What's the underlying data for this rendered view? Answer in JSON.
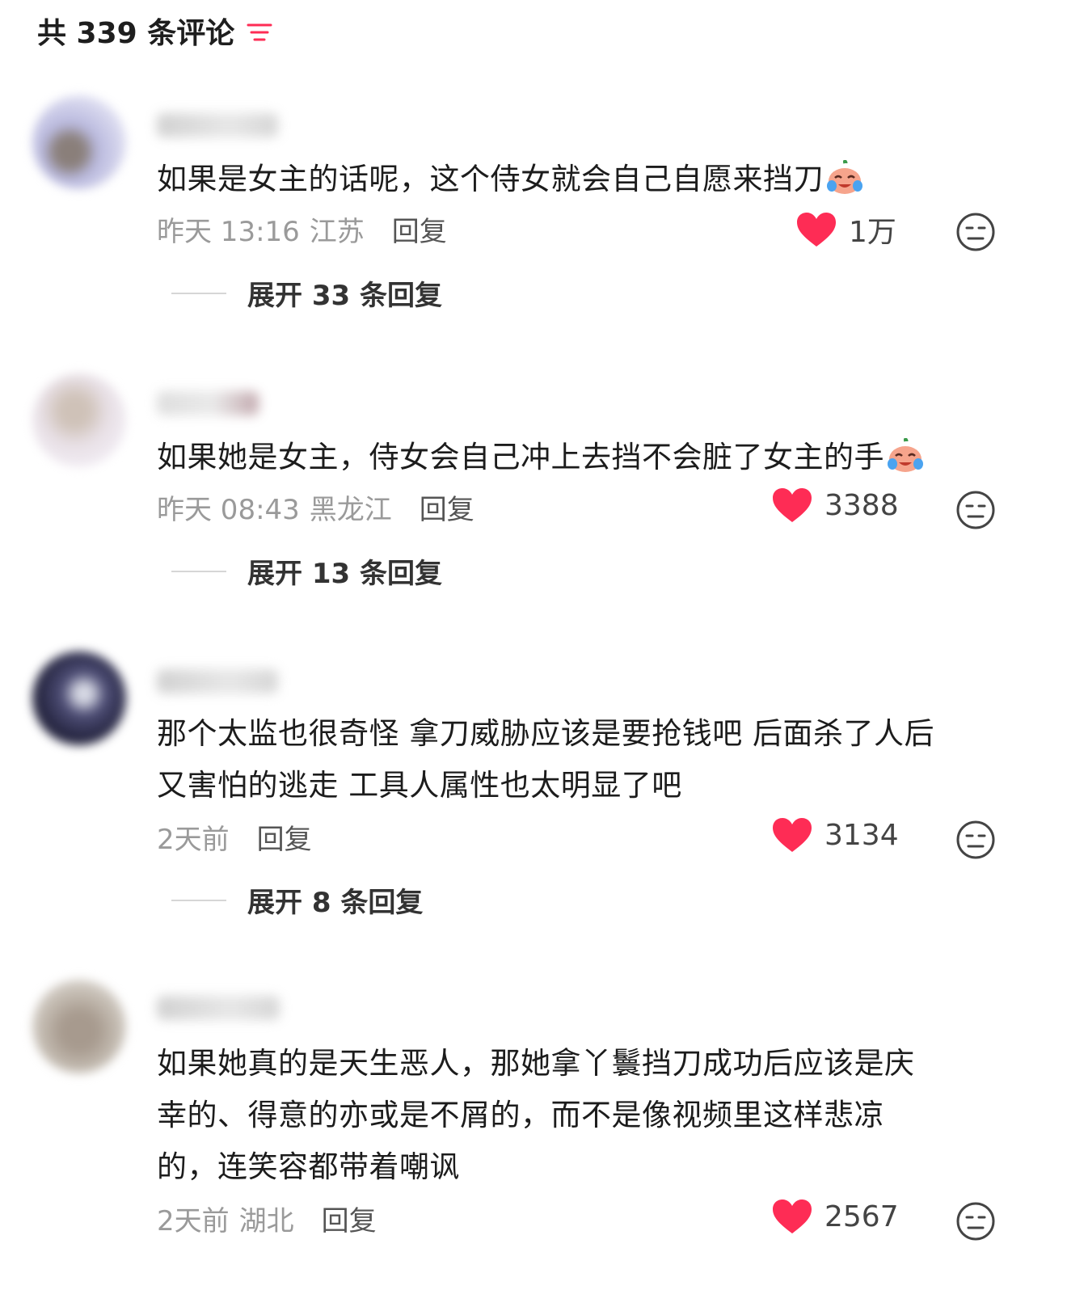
{
  "header": {
    "title": "共 339 条评论"
  },
  "comments": [
    {
      "text": "如果是女主的话呢，这个侍女就会自己自愿来挡刀",
      "time": "昨天 13:16",
      "location": "江苏",
      "reply_label": "回复",
      "likes": "1万",
      "expand_label": "展开 33 条回复"
    },
    {
      "text": "如果她是女主，侍女会自己冲上去挡不会脏了女主的手",
      "time": "昨天 08:43",
      "location": "黑龙江",
      "reply_label": "回复",
      "likes": "3388",
      "expand_label": "展开 13 条回复"
    },
    {
      "text_line1": "那个太监也很奇怪 拿刀威胁应该是要抢钱吧 后面杀了人后",
      "text_line2": "又害怕的逃走 工具人属性也太明显了吧",
      "time": "2天前",
      "reply_label": "回复",
      "likes": "3134",
      "expand_label": "展开 8 条回复"
    },
    {
      "text_line1": "如果她真的是天生恶人，那她拿丫鬟挡刀成功后应该是庆",
      "text_line2": "幸的、得意的亦或是不屑的，而不是像视频里这样悲凉",
      "text_line3": "的，连笑容都带着嘲讽",
      "time": "2天前",
      "location": "湖北",
      "reply_label": "回复",
      "likes": "2567"
    }
  ],
  "colors": {
    "like": "#fe2c55",
    "accent": "#fe2c55"
  },
  "icons": [
    "filter-icon",
    "crying-laughing-emoji",
    "heart-icon",
    "dislike-face-icon"
  ]
}
